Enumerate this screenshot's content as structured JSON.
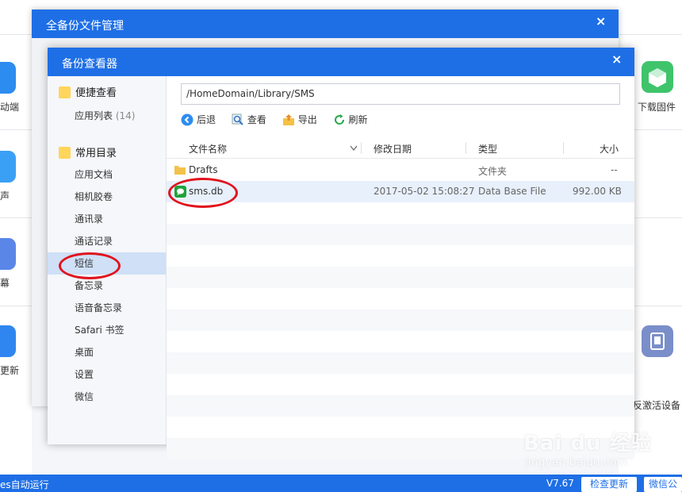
{
  "background": {
    "left_labels": [
      "动端",
      "声",
      "幕",
      "更新"
    ],
    "right_labels": [
      "下载固件",
      "反激活设备"
    ],
    "status": {
      "left_text": "es自动运行",
      "version": "V7.67",
      "check_update": "检查更新",
      "wechat": "微信公"
    }
  },
  "outer_dialog": {
    "title": "全备份文件管理",
    "close": "×"
  },
  "inner_dialog": {
    "title": "备份查看器",
    "close": "×"
  },
  "sidebar": {
    "quick_view": "便捷查看",
    "app_list": "应用列表",
    "app_list_count": "(14)",
    "common_dirs": "常用目录",
    "items": [
      {
        "label": "应用文档"
      },
      {
        "label": "相机胶卷"
      },
      {
        "label": "通讯录"
      },
      {
        "label": "通话记录"
      },
      {
        "label": "短信"
      },
      {
        "label": "备忘录"
      },
      {
        "label": "语音备忘录"
      },
      {
        "label": "Safari 书签"
      },
      {
        "label": "桌面"
      },
      {
        "label": "设置"
      },
      {
        "label": "微信"
      }
    ],
    "active_index": 4
  },
  "main": {
    "path": "/HomeDomain/Library/SMS",
    "toolbar": {
      "back": "后退",
      "view": "查看",
      "export": "导出",
      "refresh": "刷新"
    },
    "columns": {
      "name": "文件名称",
      "modified": "修改日期",
      "type": "类型",
      "size": "大小"
    },
    "rows": [
      {
        "name": "Drafts",
        "modified": "",
        "type": "文件夹",
        "size": "--",
        "icon": "folder-icon"
      },
      {
        "name": "sms.db",
        "modified": "2017-05-02 15:08:27",
        "type": "Data Base File",
        "size": "992.00 KB",
        "icon": "message-icon"
      }
    ]
  },
  "watermark": {
    "brand": "Bai du 经验",
    "url": "jingyan.baidu.com"
  },
  "colors": {
    "accent": "#1e6fe6",
    "highlight": "#e0141e"
  }
}
